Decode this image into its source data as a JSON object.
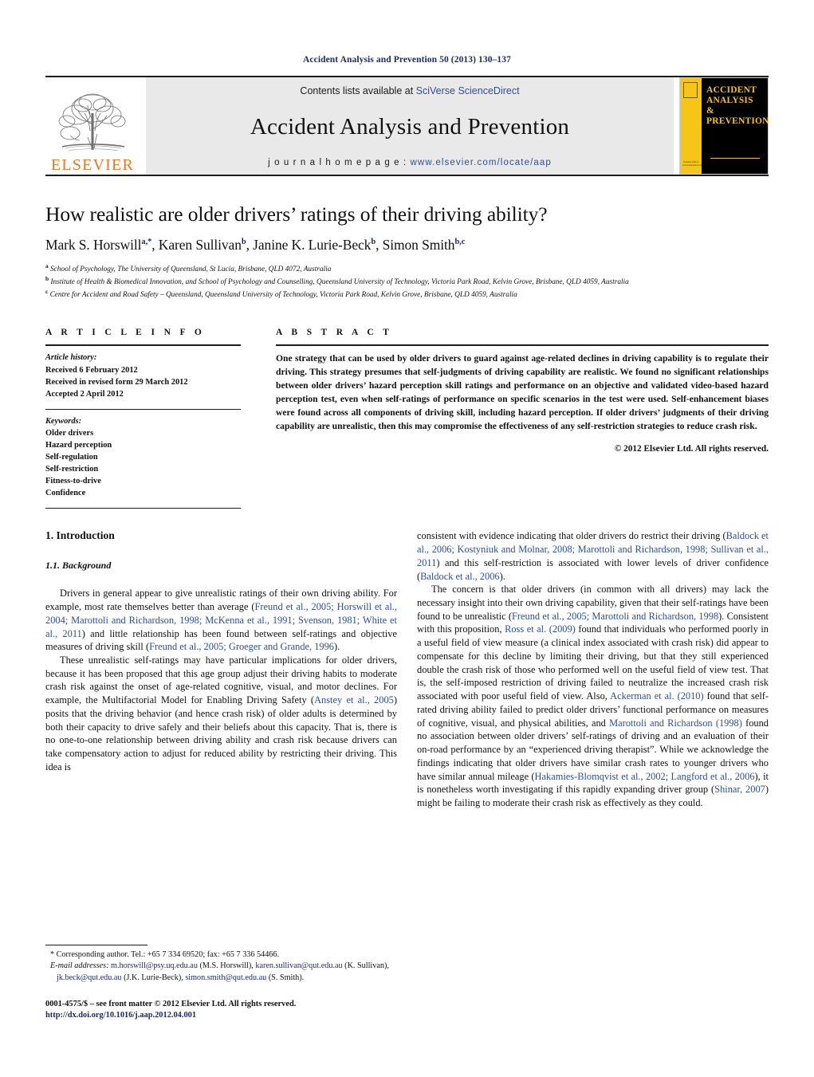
{
  "running_head": "Accident Analysis and Prevention 50 (2013) 130–137",
  "masthead": {
    "publisher_name": "ELSEVIER",
    "contents_prefix": "Contents lists available at ",
    "contents_link": "SciVerse ScienceDirect",
    "journal_title": "Accident Analysis and Prevention",
    "homepage_prefix": "j o u r n a l   h o m e p a g e :  ",
    "homepage_url": "www.elsevier.com/locate/aap",
    "cover_title_lines": [
      "ACCIDENT",
      "ANALYSIS",
      "&",
      "PREVENTION"
    ],
    "cover_foot": "Available online at www.sciencedirect.com"
  },
  "article": {
    "title": "How realistic are older drivers’ ratings of their driving ability?",
    "authors_html": "Mark S. Horswill<sup>a,*</sup>, Karen Sullivan<sup>b</sup>, Janine K. Lurie-Beck<sup>b</sup>, Simon Smith<sup>b,c</sup>",
    "affiliations": [
      "School of Psychology, The University of Queensland, St Lucia, Brisbane, QLD 4072, Australia",
      "Institute of Health & Biomedical Innovation, and School of Psychology and Counselling, Queensland University of Technology, Victoria Park Road, Kelvin Grove, Brisbane, QLD 4059, Australia",
      "Centre for Accident and Road Safety – Queensland, Queensland University of Technology, Victoria Park Road, Kelvin Grove, Brisbane, QLD 4059, Australia"
    ],
    "affiliation_marks": [
      "a",
      "b",
      "c"
    ]
  },
  "article_info": {
    "heading": "A R T I C L E    I N F O",
    "history_label": "Article history:",
    "history": [
      "Received 6 February 2012",
      "Received in revised form 29 March 2012",
      "Accepted 2 April 2012"
    ],
    "keywords_label": "Keywords:",
    "keywords": [
      "Older drivers",
      "Hazard perception",
      "Self-regulation",
      "Self-restriction",
      "Fitness-to-drive",
      "Confidence"
    ]
  },
  "abstract": {
    "heading": "A B S T R A C T",
    "text": "One strategy that can be used by older drivers to guard against age-related declines in driving capability is to regulate their driving. This strategy presumes that self-judgments of driving capability are realistic. We found no significant relationships between older drivers’ hazard perception skill ratings and performance on an objective and validated video-based hazard perception test, even when self-ratings of performance on specific scenarios in the test were used. Self-enhancement biases were found across all components of driving skill, including hazard perception. If older drivers’ judgments of their driving capability are unrealistic, then this may compromise the effectiveness of any self-restriction strategies to reduce crash risk.",
    "copyright": "© 2012 Elsevier Ltd. All rights reserved."
  },
  "body": {
    "section_heading": "1.  Introduction",
    "subsection_heading": "1.1.  Background",
    "left_paragraphs": [
      "Drivers in general appear to give unrealistic ratings of their own driving ability. For example, most rate themselves better than average (<span class=\"cite\">Freund et al., 2005; Horswill et al., 2004; Marottoli and Richardson, 1998; McKenna et al., 1991; Svenson, 1981; White et al., 2011</span>) and little relationship has been found between self-ratings and objective measures of driving skill (<span class=\"cite\">Freund et al., 2005; Groeger and Grande, 1996</span>).",
      "These unrealistic self-ratings may have particular implications for older drivers, because it has been proposed that this age group adjust their driving habits to moderate crash risk against the onset of age-related cognitive, visual, and motor declines. For example, the Multifactorial Model for Enabling Driving Safety (<span class=\"cite\">Anstey et al., 2005</span>) posits that the driving behavior (and hence crash risk) of older adults is determined by both their capacity to drive safely and their beliefs about this capacity. That is, there is no one-to-one relationship between driving ability and crash risk because drivers can take compensatory action to adjust for reduced ability by restricting their driving. This idea is"
    ],
    "right_paragraphs": [
      "consistent with evidence indicating that older drivers do restrict their driving (<span class=\"cite\">Baldock et al., 2006; Kostyniuk and Molnar, 2008; Marottoli and Richardson, 1998; Sullivan et al., 2011</span>) and this self-restriction is associated with lower levels of driver confidence (<span class=\"cite\">Baldock et al., 2006</span>).",
      "The concern is that older drivers (in common with all drivers) may lack the necessary insight into their own driving capability, given that their self-ratings have been found to be unrealistic (<span class=\"cite\">Freund et al., 2005; Marottoli and Richardson, 1998</span>). Consistent with this proposition, <span class=\"cite\">Ross et al. (2009)</span> found that individuals who performed poorly in a useful field of view measure (a clinical index associated with crash risk) did appear to compensate for this decline by limiting their driving, but that they still experienced double the crash risk of those who performed well on the useful field of view test. That is, the self-imposed restriction of driving failed to neutralize the increased crash risk associated with poor useful field of view. Also, <span class=\"cite\">Ackerman et al. (2010)</span> found that self-rated driving ability failed to predict older drivers’ functional performance on measures of cognitive, visual, and physical abilities, and <span class=\"cite\">Marottoli and Richardson (1998)</span> found no association between older drivers’ self-ratings of driving and an evaluation of their on-road performance by an “experienced driving therapist”. While we acknowledge the findings indicating that older drivers have similar crash rates to younger drivers who have similar annual mileage (<span class=\"cite\">Hakamies-Blomqvist et al., 2002; Langford et al., 2006</span>), it is nonetheless worth investigating if this rapidly expanding driver group (<span class=\"cite\">Shinar, 2007</span>) might be failing to moderate their crash risk as effectively as they could."
    ]
  },
  "footnotes": {
    "corresponding": "* Corresponding author. Tel.: +65 7 334 69520; fax: +65 7 336 54466.",
    "email_label": "E-mail addresses:",
    "emails_html": "<span class=\"mail\">m.horswill@psy.uq.edu.au</span> (M.S. Horswill), <span class=\"mail\">karen.sullivan@qut.edu.au</span> (K. Sullivan), <span class=\"mail\">jk.beck@qut.edu.au</span> (J.K. Lurie-Beck), <span class=\"mail\">simon.smith@qut.edu.au</span> (S. Smith).",
    "issn_line": "0001-4575/$ – see front matter © 2012 Elsevier Ltd. All rights reserved.",
    "doi": "http://dx.doi.org/10.1016/j.aap.2012.04.001"
  },
  "colors": {
    "link_blue": "#2b4ea2",
    "header_navy": "#1b2a6b",
    "elsevier_orange": "#E87722",
    "cover_yellow": "#f5c518",
    "banner_gray": "#e9e9e9"
  }
}
